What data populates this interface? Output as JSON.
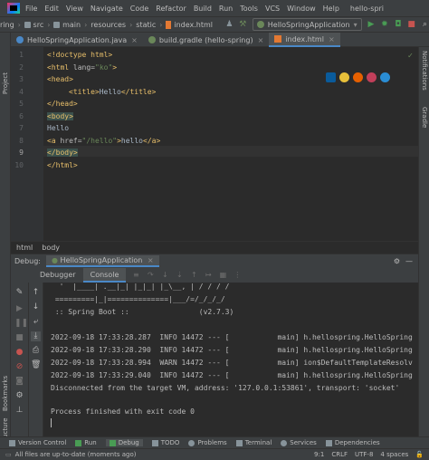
{
  "menu": [
    "File",
    "Edit",
    "View",
    "Navigate",
    "Code",
    "Refactor",
    "Build",
    "Run",
    "Tools",
    "VCS",
    "Window",
    "Help"
  ],
  "app_title": "hello-spri",
  "nav": {
    "crumbs": [
      "ring",
      "src",
      "main",
      "resources",
      "static",
      "index.html"
    ],
    "run_config": "HelloSpringApplication"
  },
  "tabs": [
    {
      "label": "HelloSpringApplication.java",
      "color": "#4a88c7"
    },
    {
      "label": "build.gradle (hello-spring)",
      "color": "#6a8759"
    },
    {
      "label": "index.html",
      "color": "#e37933"
    }
  ],
  "left_strip": {
    "project": "Project",
    "bookmarks": "Bookmarks",
    "structure": "Structure"
  },
  "right_strip": {
    "notifications": "Notifications",
    "gradle": "Gradle"
  },
  "editor": {
    "line_numbers": [
      "1",
      "2",
      "3",
      "4",
      "5",
      "6",
      "7",
      "8",
      "9",
      "10"
    ],
    "lines": {
      "l1": "<!doctype html>",
      "l2a": "<html ",
      "l2b": "lang=",
      "l2c": "\"ko\"",
      "l2d": ">",
      "l3": "<head>",
      "l4a": "<title>",
      "l4b": "Hello",
      "l4c": "</title>",
      "l5": "</head>",
      "l6": "<body>",
      "l7": "Hello",
      "l8a": "<a ",
      "l8b": "href=",
      "l8c": "\"/hello\"",
      "l8d": ">",
      "l8e": "hello",
      "l8f": "</a>",
      "l9": "</body>",
      "l10": "</html>"
    }
  },
  "breadcrumb": [
    "html",
    "body"
  ],
  "debug": {
    "label": "Debug:",
    "session": "HelloSpringApplication",
    "tabs": [
      "Debugger",
      "Console"
    ],
    "console_lines": [
      "  '  |____| .__|_| |_|_| |_\\__, | / / / /",
      " =========|_|==============|___/=/_/_/_/",
      " :: Spring Boot ::                (v2.7.3)",
      "",
      "2022-09-18 17:33:28.287  INFO 14472 --- [           main] h.hellospring.HelloSpring",
      "2022-09-18 17:33:28.290  INFO 14472 --- [           main] h.hellospring.HelloSpring",
      "2022-09-18 17:33:28.994  WARN 14472 --- [           main] ion$DefaultTemplateResolv",
      "2022-09-18 17:33:29.040  INFO 14472 --- [           main] h.hellospring.HelloSpring",
      "Disconnected from the target VM, address: '127.0.0.1:53861', transport: 'socket'",
      "",
      "Process finished with exit code 0"
    ]
  },
  "bottom_tools": [
    "Version Control",
    "Run",
    "Debug",
    "TODO",
    "Problems",
    "Terminal",
    "Services",
    "Dependencies"
  ],
  "status": {
    "message": "All files are up-to-date (moments ago)",
    "position": "9:1",
    "line_sep": "CRLF",
    "encoding": "UTF-8",
    "indent": "4 spaces"
  }
}
